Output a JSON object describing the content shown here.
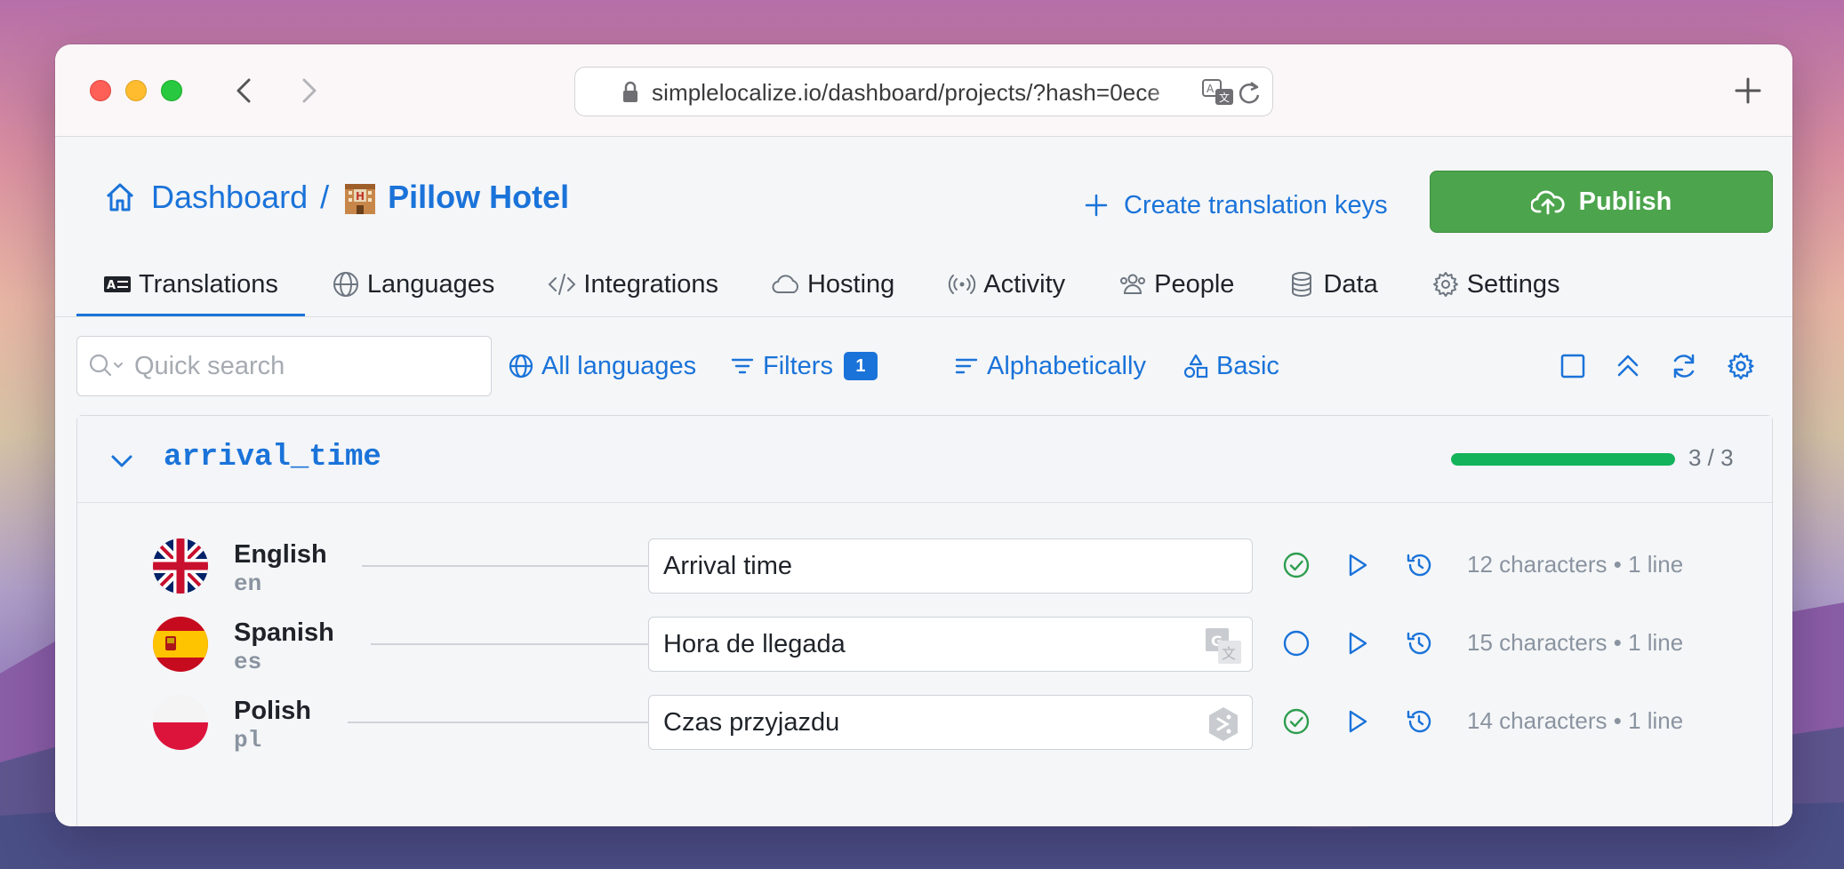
{
  "browser": {
    "url": "simplelocalize.io/dashboard/projects/?hash=0ece"
  },
  "header": {
    "breadcrumb_root": "Dashboard",
    "breadcrumb_sep": "/",
    "project_name": "Pillow Hotel",
    "create_keys_label": "Create translation keys",
    "publish_label": "Publish"
  },
  "tabs": [
    {
      "label": "Translations",
      "icon": "translations-icon",
      "active": true
    },
    {
      "label": "Languages",
      "icon": "globe-icon"
    },
    {
      "label": "Integrations",
      "icon": "code-icon"
    },
    {
      "label": "Hosting",
      "icon": "cloud-icon"
    },
    {
      "label": "Activity",
      "icon": "broadcast-icon"
    },
    {
      "label": "People",
      "icon": "people-icon"
    },
    {
      "label": "Data",
      "icon": "database-icon"
    },
    {
      "label": "Settings",
      "icon": "gear-icon"
    }
  ],
  "toolbar": {
    "search_placeholder": "Quick search",
    "languages_label": "All languages",
    "filters_label": "Filters",
    "filters_count": "1",
    "sort_label": "Alphabetically",
    "view_label": "Basic"
  },
  "key": {
    "name": "arrival_time",
    "progress_text": "3 / 3",
    "progress_fraction": 1.0,
    "colors": {
      "accent": "#1a73d9",
      "progress": "#12b35a",
      "publish": "#4ca44c",
      "reviewed": "#2e9e4f"
    },
    "translations": [
      {
        "language": "English",
        "code": "en",
        "value": "Arrival time",
        "reviewed": true,
        "stats": "12 characters • 1 line",
        "mt_icon": ""
      },
      {
        "language": "Spanish",
        "code": "es",
        "value": "Hora de llegada",
        "reviewed": false,
        "stats": "15 characters • 1 line",
        "mt_icon": "google-translate-icon"
      },
      {
        "language": "Polish",
        "code": "pl",
        "value": "Czas przyjazdu",
        "reviewed": true,
        "stats": "14 characters • 1 line",
        "mt_icon": "deepl-icon"
      }
    ]
  }
}
